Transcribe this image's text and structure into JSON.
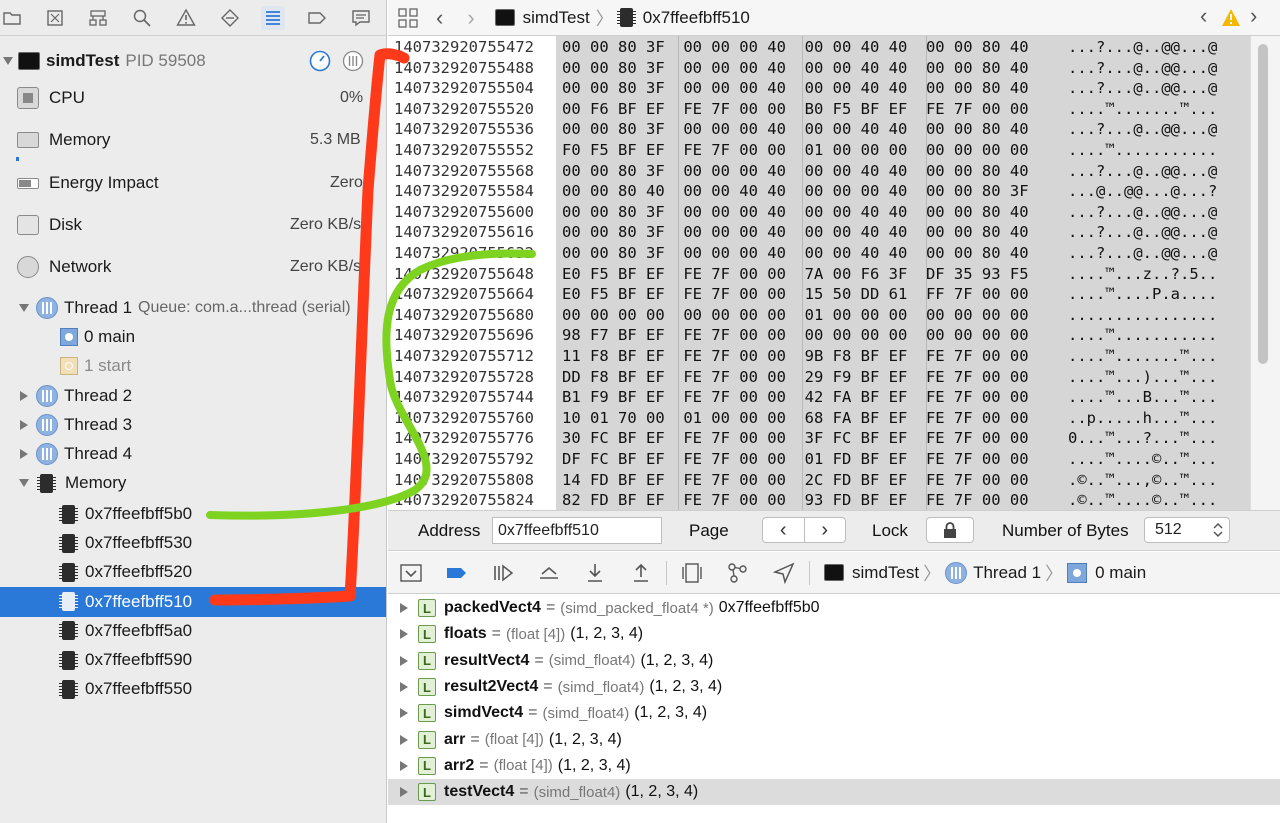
{
  "navigator": {
    "tabs": [
      "folder-icon",
      "source-control-icon",
      "hierarchy-icon",
      "find-icon",
      "issue-icon",
      "test-icon",
      "debug-icon",
      "breakpoint-icon",
      "report-icon"
    ],
    "process": {
      "name": "simdTest",
      "pid": "PID 59508"
    },
    "gauges": [
      {
        "label": "CPU",
        "value": "0%",
        "fill": 0.0
      },
      {
        "label": "Memory",
        "value": "5.3 MB",
        "fill": 0.01
      },
      {
        "label": "Energy Impact",
        "value": "Zero",
        "fill": 0.0
      },
      {
        "label": "Disk",
        "value": "Zero KB/s",
        "fill": 0.0
      },
      {
        "label": "Network",
        "value": "Zero KB/s",
        "fill": 0.0
      }
    ],
    "thread1": {
      "label": "Thread 1",
      "queue": "Queue: com.a...thread (serial)"
    },
    "frames": [
      {
        "label": "0 main"
      },
      {
        "label": "1 start"
      }
    ],
    "threads": [
      "Thread 2",
      "Thread 3",
      "Thread 4"
    ],
    "memory_group": "Memory",
    "memory_items": [
      "0x7ffeefbff5b0",
      "0x7ffeefbff530",
      "0x7ffeefbff520",
      "0x7ffeefbff510",
      "0x7ffeefbff5a0",
      "0x7ffeefbff590",
      "0x7ffeefbff550"
    ],
    "selected_memory_index": 3
  },
  "jumpbar": {
    "project": "simdTest",
    "file": "0x7ffeefbff510"
  },
  "memory_view": {
    "rows": [
      {
        "addr": "140732920755472",
        "hex": "00 00 80 3F  00 00 00 40  00 00 40 40  00 00 80 40",
        "ascii": "...?...@..@@...@"
      },
      {
        "addr": "140732920755488",
        "hex": "00 00 80 3F  00 00 00 40  00 00 40 40  00 00 80 40",
        "ascii": "...?...@..@@...@"
      },
      {
        "addr": "140732920755504",
        "hex": "00 00 80 3F  00 00 00 40  00 00 40 40  00 00 80 40",
        "ascii": "...?...@..@@...@"
      },
      {
        "addr": "140732920755520",
        "hex": "00 F6 BF EF  FE 7F 00 00  B0 F5 BF EF  FE 7F 00 00",
        "ascii": "....™.......™..."
      },
      {
        "addr": "140732920755536",
        "hex": "00 00 80 3F  00 00 00 40  00 00 40 40  00 00 80 40",
        "ascii": "...?...@..@@...@"
      },
      {
        "addr": "140732920755552",
        "hex": "F0 F5 BF EF  FE 7F 00 00  01 00 00 00  00 00 00 00",
        "ascii": "....™..........."
      },
      {
        "addr": "140732920755568",
        "hex": "00 00 80 3F  00 00 00 40  00 00 40 40  00 00 80 40",
        "ascii": "...?...@..@@...@"
      },
      {
        "addr": "140732920755584",
        "hex": "00 00 80 40  00 00 40 40  00 00 00 40  00 00 80 3F",
        "ascii": "...@..@@...@...?"
      },
      {
        "addr": "140732920755600",
        "hex": "00 00 80 3F  00 00 00 40  00 00 40 40  00 00 80 40",
        "ascii": "...?...@..@@...@"
      },
      {
        "addr": "140732920755616",
        "hex": "00 00 80 3F  00 00 00 40  00 00 40 40  00 00 80 40",
        "ascii": "...?...@..@@...@"
      },
      {
        "addr": "140732920755632",
        "hex": "00 00 80 3F  00 00 00 40  00 00 40 40  00 00 80 40",
        "ascii": "...?...@..@@...@"
      },
      {
        "addr": "140732920755648",
        "hex": "E0 F5 BF EF  FE 7F 00 00  7A 00 F6 3F  DF 35 93 F5",
        "ascii": "....™...z..?.5.."
      },
      {
        "addr": "140732920755664",
        "hex": "E0 F5 BF EF  FE 7F 00 00  15 50 DD 61  FF 7F 00 00",
        "ascii": "....™....P.a...."
      },
      {
        "addr": "140732920755680",
        "hex": "00 00 00 00  00 00 00 00  01 00 00 00  00 00 00 00",
        "ascii": "................"
      },
      {
        "addr": "140732920755696",
        "hex": "98 F7 BF EF  FE 7F 00 00  00 00 00 00  00 00 00 00",
        "ascii": "....™..........."
      },
      {
        "addr": "140732920755712",
        "hex": "11 F8 BF EF  FE 7F 00 00  9B F8 BF EF  FE 7F 00 00",
        "ascii": "....™.......™..."
      },
      {
        "addr": "140732920755728",
        "hex": "DD F8 BF EF  FE 7F 00 00  29 F9 BF EF  FE 7F 00 00",
        "ascii": "....™...)...™..."
      },
      {
        "addr": "140732920755744",
        "hex": "B1 F9 BF EF  FE 7F 00 00  42 FA BF EF  FE 7F 00 00",
        "ascii": "....™...B...™..."
      },
      {
        "addr": "140732920755760",
        "hex": "10 01 70 00  01 00 00 00  68 FA BF EF  FE 7F 00 00",
        "ascii": "..p.....h...™..."
      },
      {
        "addr": "140732920755776",
        "hex": "30 FC BF EF  FE 7F 00 00  3F FC BF EF  FE 7F 00 00",
        "ascii": "0...™...?...™..."
      },
      {
        "addr": "140732920755792",
        "hex": "DF FC BF EF  FE 7F 00 00  01 FD BF EF  FE 7F 00 00",
        "ascii": "....™....©..™..."
      },
      {
        "addr": "140732920755808",
        "hex": "14 FD BF EF  FE 7F 00 00  2C FD BF EF  FE 7F 00 00",
        "ascii": ".©..™...,©..™..."
      },
      {
        "addr": "140732920755824",
        "hex": "82 FD BF EF  FE 7F 00 00  93 FD BF EF  FE 7F 00 00",
        "ascii": ".©..™....©..™..."
      }
    ]
  },
  "memory_bar": {
    "address_label": "Address",
    "address_value": "0x7ffeefbff510",
    "page_label": "Page",
    "lock_label": "Lock",
    "bytes_label": "Number of Bytes",
    "bytes_value": "512"
  },
  "debug_bar": {
    "process": "simdTest",
    "thread": "Thread 1",
    "frame": "0 main"
  },
  "variables": [
    {
      "name": "packedVect4",
      "type": "(simd_packed_float4 *)",
      "value": "0x7ffeefbff5b0"
    },
    {
      "name": "floats",
      "type": "(float [4])",
      "value": "(1, 2, 3, 4)"
    },
    {
      "name": "resultVect4",
      "type": "(simd_float4)",
      "value": "(1, 2, 3, 4)"
    },
    {
      "name": "result2Vect4",
      "type": "(simd_float4)",
      "value": "(1, 2, 3, 4)"
    },
    {
      "name": "simdVect4",
      "type": "(simd_float4)",
      "value": "(1, 2, 3, 4)"
    },
    {
      "name": "arr",
      "type": "(float [4])",
      "value": "(1, 2, 3, 4)"
    },
    {
      "name": "arr2",
      "type": "(float [4])",
      "value": "(1, 2, 3, 4)"
    },
    {
      "name": "testVect4",
      "type": "(simd_float4)",
      "value": "(1, 2, 3, 4)"
    }
  ],
  "colors": {
    "selection": "#2a79d8",
    "annotation_red": "#ff3a1a",
    "annotation_green": "#7ed321",
    "warning": "#f5b800"
  }
}
